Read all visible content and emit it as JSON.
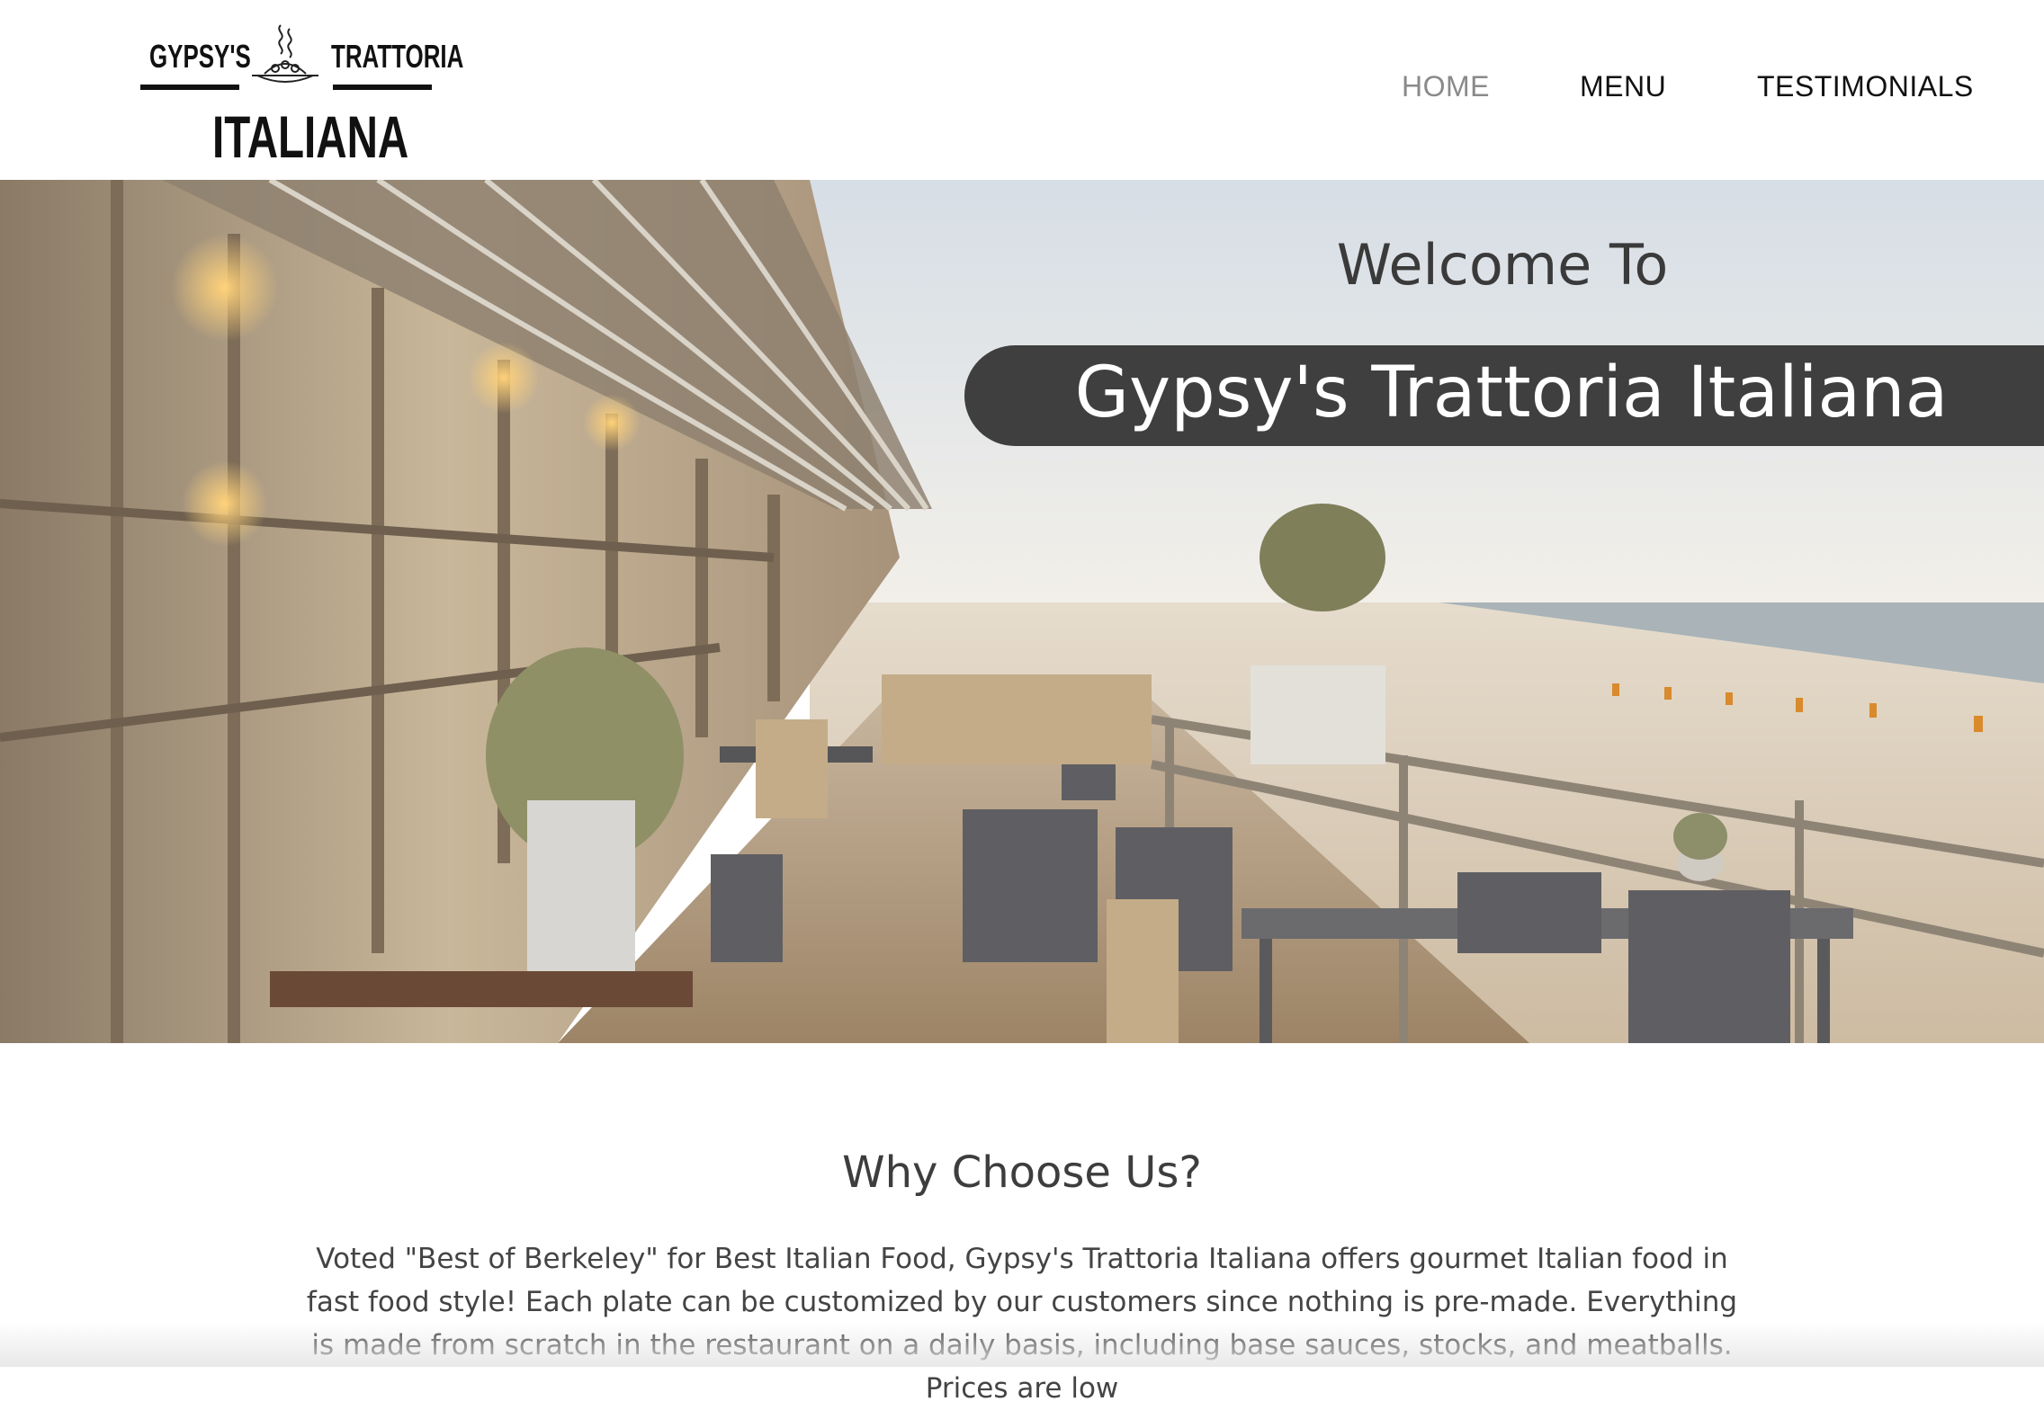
{
  "logo": {
    "word_left": "GYPSY'S",
    "word_right": "TRATTORIA",
    "word_bottom": "ITALIANA",
    "icon": "pasta-dish-icon"
  },
  "nav": {
    "items": [
      {
        "label": "HOME",
        "active": true
      },
      {
        "label": "MENU",
        "active": false
      },
      {
        "label": "TESTIMONIALS",
        "active": false
      }
    ],
    "active_color": "#8a8a8a",
    "color": "#111111"
  },
  "hero": {
    "welcome": "Welcome To",
    "title": "Gypsy's Trattoria Italiana",
    "banner_color": "#3f3f3f",
    "image": "beach-restaurant-terrace-photo"
  },
  "why": {
    "title": "Why Choose Us?",
    "body": "Voted \"Best of Berkeley\" for Best Italian Food, Gypsy's Trattoria Italiana offers gourmet Italian food in fast food style! Each plate can be customized by our customers since nothing is pre-made. Everything is made from scratch in the restaurant on a daily basis, including base sauces, stocks, and meatballs. Prices are low"
  }
}
